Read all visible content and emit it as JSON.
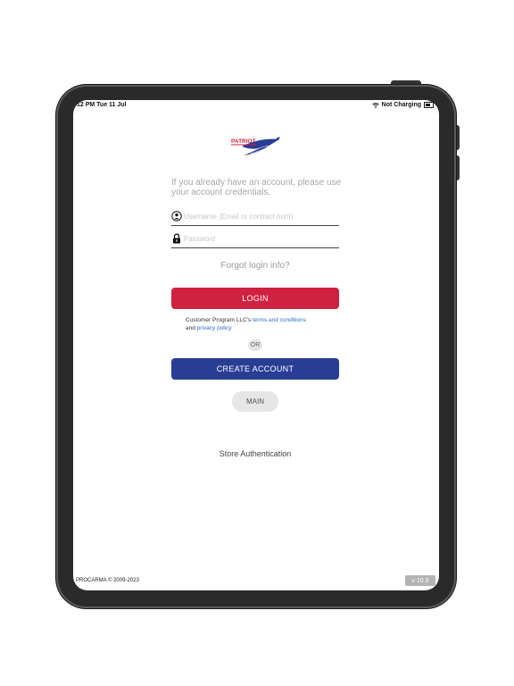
{
  "status_bar": {
    "time_date": "12 PM  Tue 11 Jul",
    "charging": "Not Charging"
  },
  "logo": {
    "text": "PATRIOT",
    "colors": {
      "red": "#cf2140",
      "blue": "#293d94"
    }
  },
  "intro": {
    "text": "If you already have an account, please use your account credentials."
  },
  "form": {
    "username_placeholder": "Username (Email or contract num)",
    "password_placeholder": "Password"
  },
  "forgot_label": "Forgot login info?",
  "login_label": "LOGIN",
  "terms": {
    "prefix": "Customer Program LLC's",
    "terms_link": "terms and conditions",
    "and": "and",
    "privacy_link": "privacy policy"
  },
  "or_label": "OR",
  "create_account_label": "CREATE ACCOUNT",
  "main_label": "MAIN",
  "store_auth_label": "Store Authentication",
  "footer": {
    "copyright": "PROCARMA © 2009-2023",
    "version": "v 10.9"
  },
  "icons": {
    "username": "user-circle-icon",
    "password": "lock-icon",
    "wifi": "wifi-icon",
    "battery": "battery-icon"
  }
}
